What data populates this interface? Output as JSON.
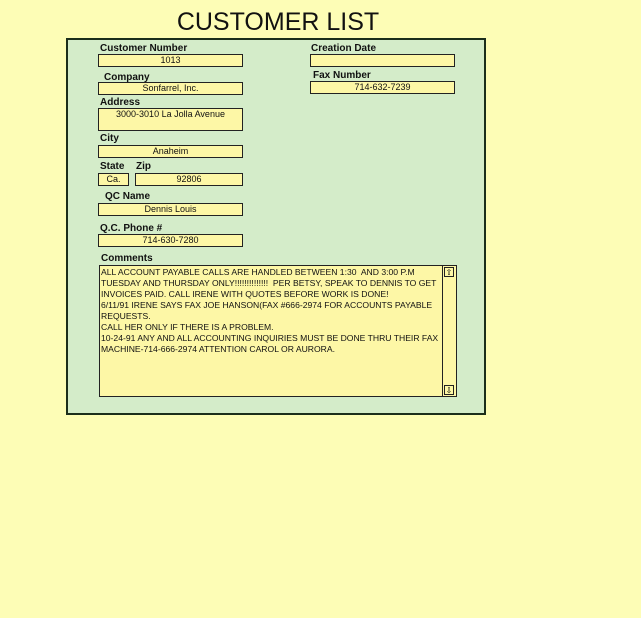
{
  "title": "CUSTOMER LIST",
  "fields": {
    "customer_number": {
      "label": "Customer Number",
      "value": "1013"
    },
    "company": {
      "label": "Company",
      "value": "Sonfarrel, Inc."
    },
    "address": {
      "label": "Address",
      "value": "3000-3010 La Jolla Avenue"
    },
    "city": {
      "label": "City",
      "value": "Anaheim"
    },
    "state": {
      "label": "State",
      "value": "Ca."
    },
    "zip": {
      "label": "Zip",
      "value": "92806"
    },
    "qc_name": {
      "label": "QC Name",
      "value": "Dennis Louis"
    },
    "qc_phone": {
      "label": "Q.C. Phone #",
      "value": "714-630-7280"
    },
    "creation_date": {
      "label": "Creation Date",
      "value": ""
    },
    "fax_number": {
      "label": "Fax Number",
      "value": "714-632-7239"
    },
    "comments": {
      "label": "Comments",
      "value": "ALL ACCOUNT PAYABLE CALLS ARE HANDLED BETWEEN 1:30  AND 3:00 P.M TUESDAY AND THURSDAY ONLY!!!!!!!!!!!!!!  PER BETSY, SPEAK TO DENNIS TO GET INVOICES PAID. CALL IRENE WITH QUOTES BEFORE WORK IS DONE!\n6/11/91 IRENE SAYS FAX JOE HANSON(FAX #666-2974 FOR ACCOUNTS PAYABLE REQUESTS.\nCALL HER ONLY IF THERE IS A PROBLEM.\n10-24-91 ANY AND ALL ACCOUNTING INQUIRIES MUST BE DONE THRU THEIR FAX MACHINE-714-666-2974 ATTENTION CAROL OR AURORA."
    }
  },
  "icons": {
    "scroll_up": "arrow-up-icon",
    "scroll_down": "arrow-down-icon"
  }
}
